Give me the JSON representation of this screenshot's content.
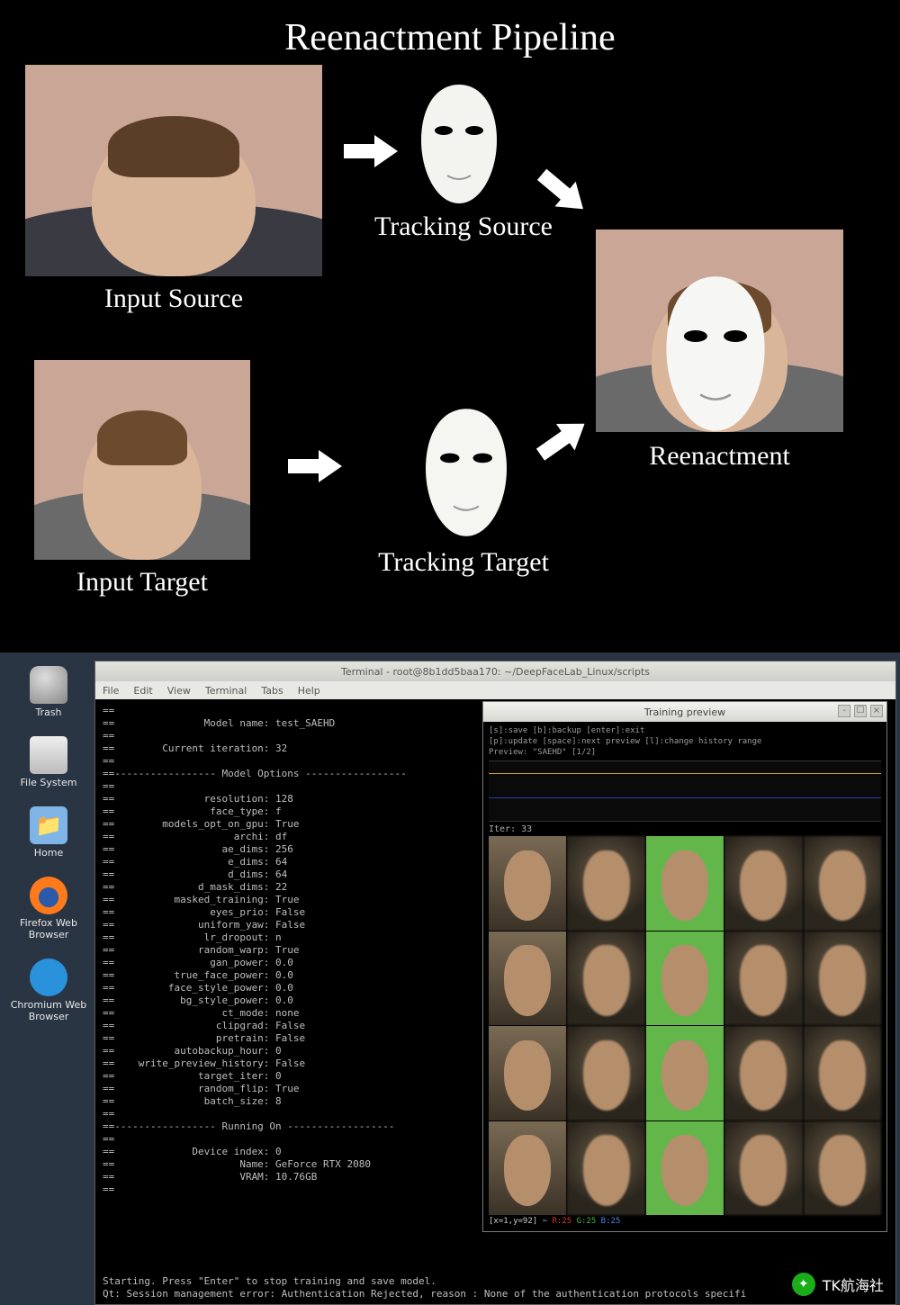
{
  "diagram": {
    "title": "Reenactment Pipeline",
    "labels": {
      "input_source": "Input Source",
      "input_target": "Input Target",
      "tracking_source": "Tracking Source",
      "tracking_target": "Tracking Target",
      "reenactment": "Reenactment"
    }
  },
  "desktop": {
    "icons": {
      "trash": "Trash",
      "filesystem": "File System",
      "home": "Home",
      "firefox": "Firefox Web Browser",
      "chromium": "Chromium Web Browser"
    }
  },
  "terminal": {
    "title": "Terminal - root@8b1dd5baa170: ~/DeepFaceLab_Linux/scripts",
    "menu": [
      "File",
      "Edit",
      "View",
      "Terminal",
      "Tabs",
      "Help"
    ],
    "header": {
      "model_name_k": "Model name:",
      "model_name_v": "test_SAEHD",
      "iter_k": "Current iteration:",
      "iter_v": "32"
    },
    "section_options": "Model Options",
    "options": [
      {
        "k": "resolution",
        "v": "128"
      },
      {
        "k": "face_type",
        "v": "f"
      },
      {
        "k": "models_opt_on_gpu",
        "v": "True"
      },
      {
        "k": "archi",
        "v": "df"
      },
      {
        "k": "ae_dims",
        "v": "256"
      },
      {
        "k": "e_dims",
        "v": "64"
      },
      {
        "k": "d_dims",
        "v": "64"
      },
      {
        "k": "d_mask_dims",
        "v": "22"
      },
      {
        "k": "masked_training",
        "v": "True"
      },
      {
        "k": "eyes_prio",
        "v": "False"
      },
      {
        "k": "uniform_yaw",
        "v": "False"
      },
      {
        "k": "lr_dropout",
        "v": "n"
      },
      {
        "k": "random_warp",
        "v": "True"
      },
      {
        "k": "gan_power",
        "v": "0.0"
      },
      {
        "k": "true_face_power",
        "v": "0.0"
      },
      {
        "k": "face_style_power",
        "v": "0.0"
      },
      {
        "k": "bg_style_power",
        "v": "0.0"
      },
      {
        "k": "ct_mode",
        "v": "none"
      },
      {
        "k": "clipgrad",
        "v": "False"
      },
      {
        "k": "pretrain",
        "v": "False"
      },
      {
        "k": "autobackup_hour",
        "v": "0"
      },
      {
        "k": "write_preview_history",
        "v": "False"
      },
      {
        "k": "target_iter",
        "v": "0"
      },
      {
        "k": "random_flip",
        "v": "True"
      },
      {
        "k": "batch_size",
        "v": "8"
      }
    ],
    "section_running": "Running On",
    "device": [
      {
        "k": "Device index",
        "v": "0"
      },
      {
        "k": "Name",
        "v": "GeForce RTX 2080"
      },
      {
        "k": "VRAM",
        "v": "10.76GB"
      }
    ],
    "starting": "Starting. Press \"Enter\" to stop training and save model.",
    "qt_error": "Qt: Session management error: Authentication Rejected, reason : None of the authentication protocols specifi"
  },
  "preview": {
    "title": "Training preview",
    "controls_line1": "[s]:save [b]:backup [enter]:exit",
    "controls_line2": "[p]:update [space]:next preview [l]:change history range",
    "preview_label": "Preview: \"SAEHD\" [1/2]",
    "iter": "Iter: 33",
    "status_xy": "[x=1,y=92] ~",
    "status_r": "R:25",
    "status_g": "G:25",
    "status_b": "B:25"
  },
  "watermark": {
    "text": "TK航海社"
  }
}
